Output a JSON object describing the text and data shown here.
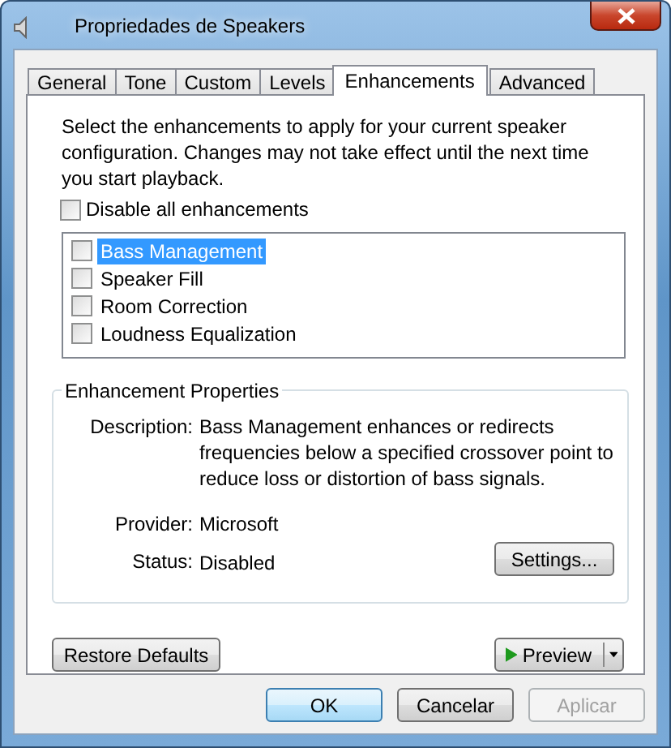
{
  "window": {
    "title": "Propriedades de Speakers"
  },
  "tabs": [
    {
      "label": "General",
      "selected": false
    },
    {
      "label": "Tone",
      "selected": false
    },
    {
      "label": "Custom",
      "selected": false
    },
    {
      "label": "Levels",
      "selected": false
    },
    {
      "label": "Enhancements",
      "selected": true
    },
    {
      "label": "Advanced",
      "selected": false
    }
  ],
  "instructions": "Select the enhancements to apply for your current speaker configuration. Changes may not take effect until the next time you start playback.",
  "disable_all": {
    "label": "Disable all enhancements",
    "checked": false
  },
  "enhancements": [
    {
      "label": "Bass Management",
      "checked": false,
      "selected": true
    },
    {
      "label": "Speaker Fill",
      "checked": false,
      "selected": false
    },
    {
      "label": "Room Correction",
      "checked": false,
      "selected": false
    },
    {
      "label": "Loudness Equalization",
      "checked": false,
      "selected": false
    }
  ],
  "properties": {
    "title": "Enhancement Properties",
    "description_label": "Description:",
    "description": "Bass Management enhances or redirects frequencies below a specified crossover point to reduce loss or distortion of bass signals.",
    "provider_label": "Provider:",
    "provider": "Microsoft",
    "status_label": "Status:",
    "status": "Disabled",
    "settings_button": "Settings..."
  },
  "restore_button": "Restore Defaults",
  "preview_button": "Preview",
  "buttons": [
    {
      "label": "OK",
      "kind": "default",
      "disabled": false
    },
    {
      "label": "Cancelar",
      "kind": "normal",
      "disabled": false
    },
    {
      "label": "Aplicar",
      "kind": "normal",
      "disabled": true
    }
  ]
}
